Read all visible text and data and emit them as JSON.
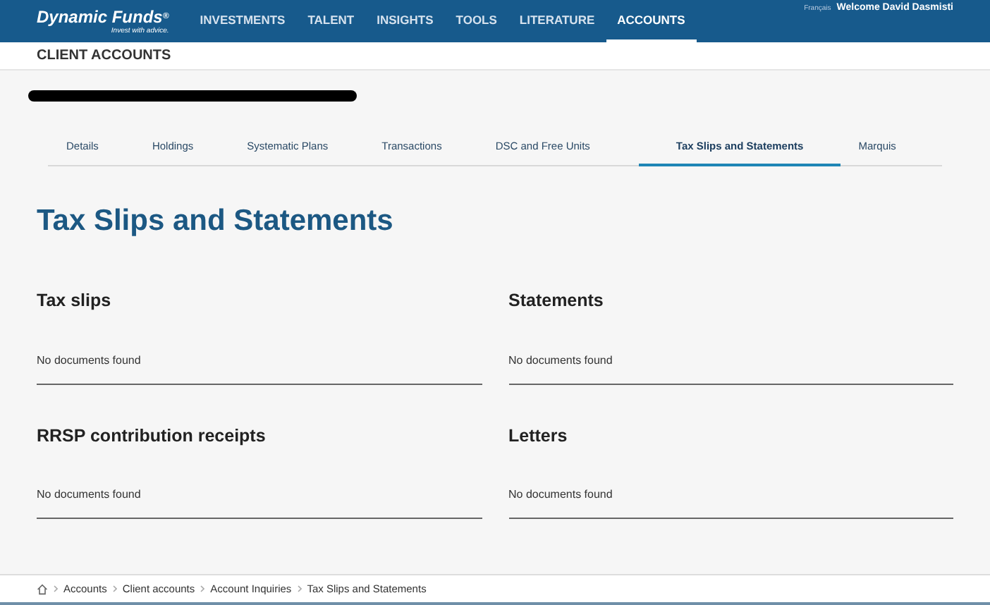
{
  "header": {
    "logo": "Dynamic Funds",
    "logo_sup": "®",
    "tagline": "Invest with advice.",
    "nav": [
      {
        "label": "INVESTMENTS",
        "selected": false
      },
      {
        "label": "TALENT",
        "selected": false
      },
      {
        "label": "INSIGHTS",
        "selected": false
      },
      {
        "label": "TOOLS",
        "selected": false
      },
      {
        "label": "LITERATURE",
        "selected": false
      },
      {
        "label": "ACCOUNTS",
        "selected": true
      }
    ],
    "language": "Français",
    "welcome": "Welcome David Dasmisti"
  },
  "section_title": "CLIENT ACCOUNTS",
  "tabs": [
    {
      "label": "Details",
      "selected": false
    },
    {
      "label": "Holdings",
      "selected": false
    },
    {
      "label": "Systematic Plans",
      "selected": false
    },
    {
      "label": "Transactions",
      "selected": false
    },
    {
      "label": "DSC and Free Units",
      "selected": false
    },
    {
      "label": "Tax Slips and Statements",
      "selected": true
    },
    {
      "label": "Marquis",
      "selected": false
    }
  ],
  "page_title": "Tax Slips and Statements",
  "panels": [
    {
      "title": "Tax slips",
      "message": "No documents found"
    },
    {
      "title": "Statements",
      "message": "No documents found"
    },
    {
      "title": "RRSP contribution receipts",
      "message": "No documents found"
    },
    {
      "title": "Letters",
      "message": "No documents found"
    }
  ],
  "breadcrumb": [
    "Accounts",
    "Client accounts",
    "Account Inquiries",
    "Tax Slips and Statements"
  ]
}
